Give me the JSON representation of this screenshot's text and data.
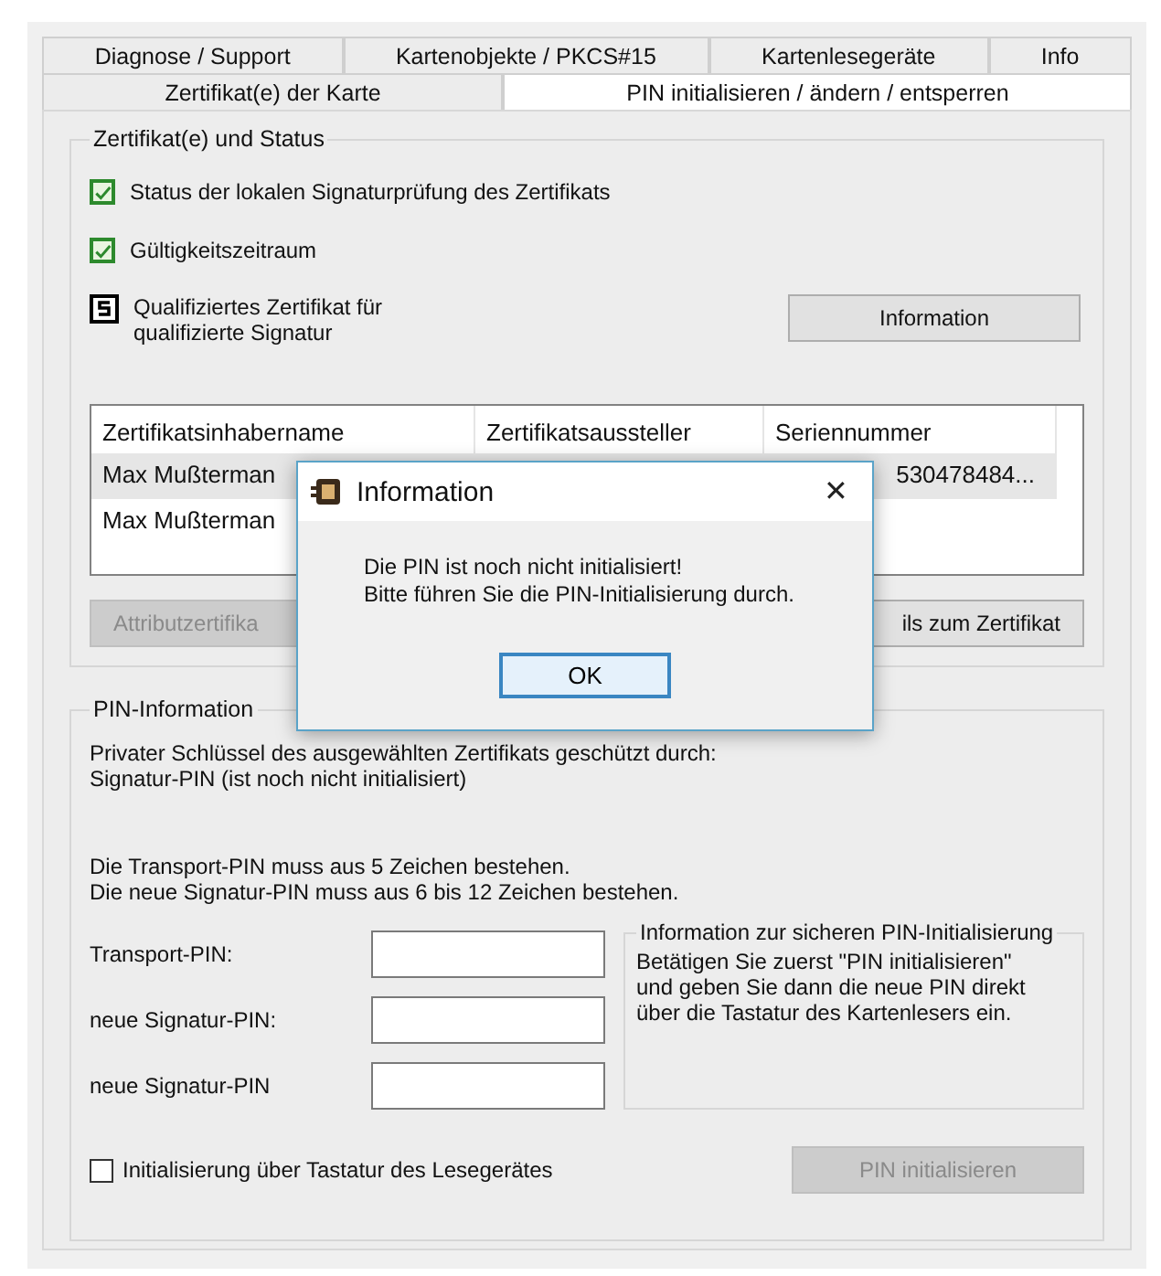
{
  "tabs": {
    "rows": [
      [
        {
          "label": "Diagnose / Support",
          "selected": false
        },
        {
          "label": "Kartenobjekte / PKCS#15",
          "selected": false
        },
        {
          "label": "Kartenlesegeräte",
          "selected": false
        },
        {
          "label": "Info",
          "selected": false
        }
      ],
      [
        {
          "label": "Zertifikat(e) der Karte",
          "selected": false
        },
        {
          "label": "PIN initialisieren / ändern / entsperren",
          "selected": true
        }
      ]
    ]
  },
  "certificate_status": {
    "title": "Zertifikat(e) und Status",
    "items": [
      {
        "kind": "check",
        "label": "Status der lokalen Signaturprüfung des Zertifikats",
        "checked": true
      },
      {
        "kind": "check",
        "label": "Gültigkeitszeitraum",
        "checked": true
      },
      {
        "kind": "qualified",
        "label": "Qualifiziertes Zertifikat für qualifizierte Signatur"
      }
    ],
    "information_button": "Information",
    "table": {
      "columns": [
        "Zertifikatsinhabername",
        "Zertifikatsaussteller",
        "Seriennummer"
      ],
      "rows": [
        {
          "cells": [
            "Max Mußterman",
            "",
            "530478484..."
          ],
          "selected": true
        },
        {
          "cells": [
            "Max Mußterman",
            "",
            ""
          ],
          "selected": false
        }
      ]
    },
    "buttons": [
      {
        "label": "Attributzertifika",
        "disabled": true
      },
      {
        "label": "ils zum Zertifikat",
        "disabled": false
      }
    ]
  },
  "pin_information": {
    "title": "PIN-Information",
    "protection": [
      "Privater Schlüssel des ausgewählten Zertifikats geschützt durch:",
      "Signatur-PIN  (ist noch nicht initialisiert)"
    ],
    "rules": [
      "Die Transport-PIN muss aus 5 Zeichen bestehen.",
      "Die neue Signatur-PIN muss aus 6 bis 12 Zeichen bestehen."
    ],
    "fields": [
      {
        "label": "Transport-PIN:"
      },
      {
        "label": "neue Signatur-PIN:"
      },
      {
        "label": "neue Signatur-PIN"
      }
    ],
    "secure_info": {
      "title": "Information zur sicheren PIN-Initialisierung",
      "text": "Betätigen Sie zuerst \"PIN initialisieren\" und geben Sie dann die neue PIN direkt über die Tastatur des Kartenlesers ein."
    },
    "keypad_option": {
      "label": "Initialisierung über Tastatur des Lesegerätes",
      "checked": false
    },
    "initialize_button": {
      "label": "PIN initialisieren",
      "disabled": true
    }
  },
  "dialog": {
    "title": "Information",
    "close": "✕",
    "message": [
      "Die PIN ist noch nicht initialisiert!",
      "Bitte führen Sie die PIN-Initialisierung durch."
    ],
    "ok": "OK"
  }
}
